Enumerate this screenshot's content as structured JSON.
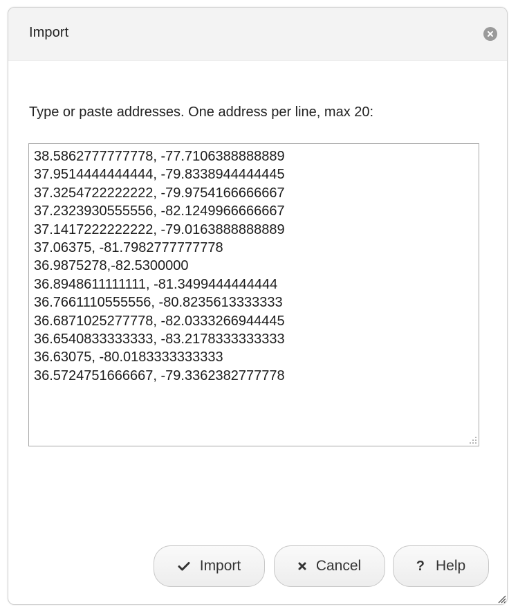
{
  "dialog": {
    "title": "Import",
    "close_icon": "circle-x-icon",
    "instructions": "Type or paste addresses. One address per line, max 20:",
    "addresses_value": "38.5862777777778, -77.7106388888889\n37.9514444444444, -79.8338944444445\n37.3254722222222, -79.9754166666667\n37.2323930555556, -82.1249966666667\n37.1417222222222, -79.0163888888889\n37.06375, -81.7982777777778\n36.9875278,-82.5300000\n36.8948611111111, -81.3499444444444\n36.7661110555556, -80.8235613333333\n36.6871025277778, -82.0333266944445\n36.6540833333333, -83.2178333333333\n36.63075, -80.0183333333333\n36.5724751666667, -79.3362382777778",
    "buttons": {
      "import_label": "Import",
      "import_icon": "checkmark-icon",
      "cancel_label": "Cancel",
      "cancel_icon": "x-icon",
      "help_label": "Help",
      "help_icon_glyph": "?"
    }
  }
}
